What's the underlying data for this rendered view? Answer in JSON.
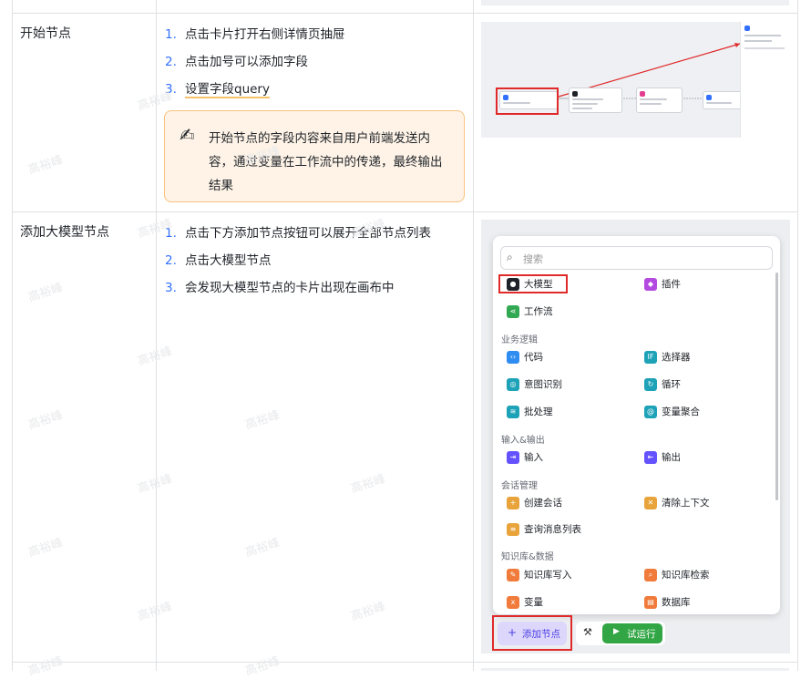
{
  "rows": [
    {
      "name": "开始节点",
      "steps": [
        "点击卡片打开右侧详情页抽屉",
        "点击加号可以添加字段",
        "设置字段query"
      ],
      "callout": "开始节点的字段内容来自用户前端发送内容，通过变量在工作流中的传递，最终输出结果"
    },
    {
      "name": "添加大模型节点",
      "steps": [
        "点击下方添加节点按钮可以展开全部节点列表",
        "点击大模型节点",
        "会发现大模型节点的卡片出现在画布中"
      ]
    }
  ],
  "step_numbers": [
    "1.",
    "2.",
    "3."
  ],
  "callout_icon": "writing-hand-icon",
  "node_menu": {
    "search_placeholder": "搜索",
    "items": [
      {
        "label": "大模型",
        "icon": "llm-icon",
        "color": "#1f2329"
      },
      {
        "label": "插件",
        "icon": "plugin-icon",
        "color": "#b34be0"
      },
      {
        "label": "工作流",
        "icon": "workflow-icon",
        "color": "#33a852"
      },
      {
        "label": "代码",
        "icon": "code-icon",
        "color": "#2f8cf0"
      },
      {
        "label": "选择器",
        "icon": "if-icon",
        "color": "#1ea2b8"
      },
      {
        "label": "意图识别",
        "icon": "intent-icon",
        "color": "#1ea2b8"
      },
      {
        "label": "循环",
        "icon": "loop-icon",
        "color": "#1ea2b8"
      },
      {
        "label": "批处理",
        "icon": "batch-icon",
        "color": "#1ea2b8"
      },
      {
        "label": "变量聚合",
        "icon": "aggregate-icon",
        "color": "#1ea2b8"
      },
      {
        "label": "输入",
        "icon": "input-icon",
        "color": "#6552ff"
      },
      {
        "label": "输出",
        "icon": "output-icon",
        "color": "#6552ff"
      },
      {
        "label": "创建会话",
        "icon": "create-session-icon",
        "color": "#e8a33a"
      },
      {
        "label": "清除上下文",
        "icon": "clear-context-icon",
        "color": "#e8a33a"
      },
      {
        "label": "查询消息列表",
        "icon": "query-messages-icon",
        "color": "#e8a33a"
      },
      {
        "label": "知识库写入",
        "icon": "kb-write-icon",
        "color": "#f07b3a"
      },
      {
        "label": "知识库检索",
        "icon": "kb-search-icon",
        "color": "#f07b3a"
      },
      {
        "label": "变量",
        "icon": "variable-icon",
        "color": "#f07b3a"
      },
      {
        "label": "数据库",
        "icon": "database-icon",
        "color": "#f07b3a"
      }
    ],
    "groups": [
      "业务逻辑",
      "输入&输出",
      "会话管理",
      "知识库&数据"
    ],
    "add_node_label": "添加节点",
    "run_label": "试运行"
  },
  "watermark": "高裕峰"
}
